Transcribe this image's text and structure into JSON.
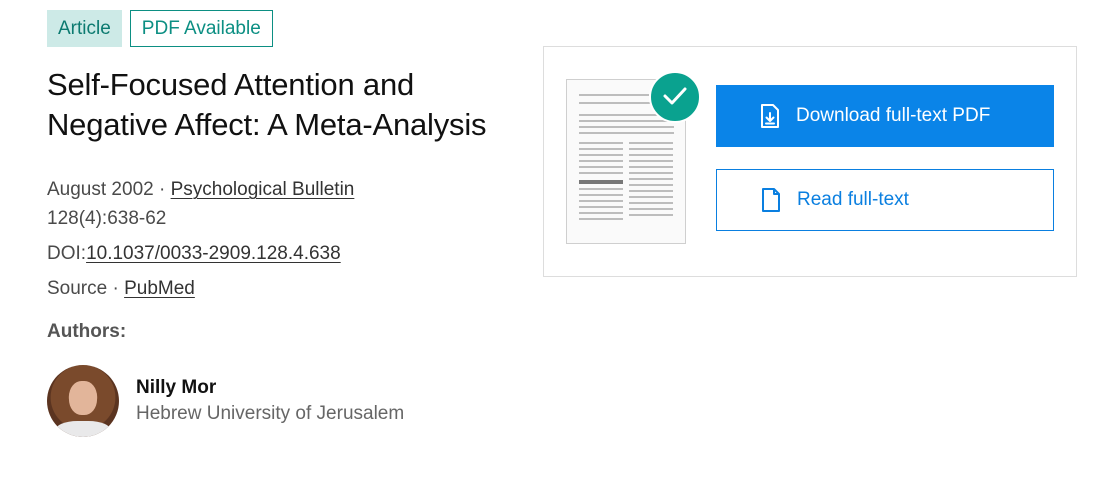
{
  "badges": {
    "article": "Article",
    "pdf": "PDF Available"
  },
  "title": "Self-Focused Attention and Negative Affect: A Meta-Analysis",
  "meta": {
    "date": "August 2002",
    "separator": "·",
    "journal": "Psychological Bulletin",
    "volume": "128(4):638-62",
    "doi_label": "DOI:",
    "doi": "10.1037/0033-2909.128.4.638",
    "source_label": "Source",
    "source": "PubMed"
  },
  "authors": {
    "heading": "Authors:",
    "list": [
      {
        "name": "Nilly Mor",
        "affiliation": "Hebrew University of Jerusalem"
      }
    ]
  },
  "fulltext": {
    "download_label": "Download full-text PDF",
    "read_label": "Read full-text",
    "download_icon": "download-file-icon",
    "read_icon": "document-icon",
    "check_icon": "checkmark-icon"
  },
  "colors": {
    "accent_blue": "#0a84e8",
    "teal": "#0aa28f",
    "badge_bg": "#cdeae7"
  }
}
